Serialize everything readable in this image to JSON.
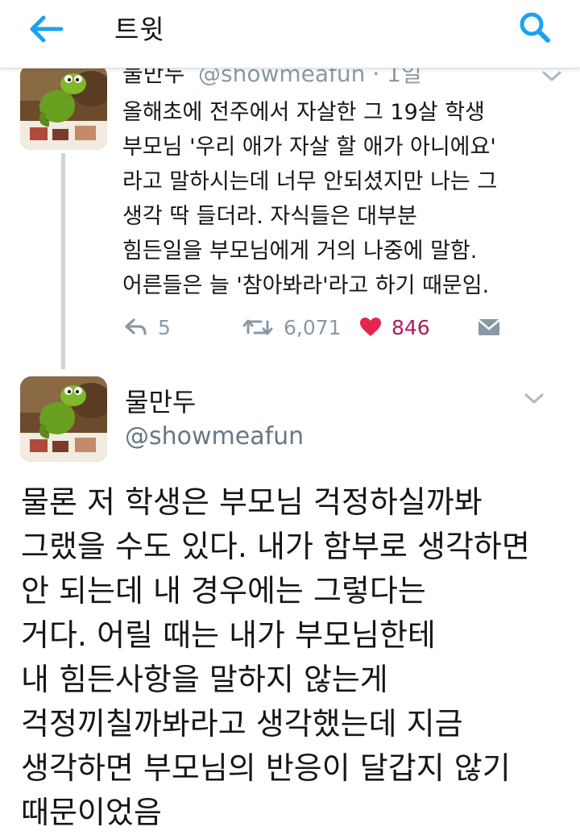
{
  "header": {
    "title": "트윗"
  },
  "reply_tweet": {
    "name": "물만두",
    "handle_time": "@showmeafun · 1일",
    "lines": [
      "올해초에 전주에서 자살한 그 19살 학생",
      "부모님 '우리 애가 자살 할 애가 아니에요'",
      "라고 말하시는데 너무 안되셨지만 나는 그",
      "생각 딱 들더라. 자식들은 대부분",
      "힘든일을 부모님에게 거의 나중에 말함.",
      "어른들은 늘 '참아봐라'라고 하기 때문임."
    ],
    "actions": {
      "reply_count": "5",
      "retweet_count": "6,071",
      "like_count": "846"
    }
  },
  "main_tweet": {
    "name": "물만두",
    "handle": "@showmeafun",
    "lines": [
      "물론 저 학생은 부모님 걱정하실까봐",
      "그랬을 수도 있다. 내가 함부로 생각하면",
      "안 되는데 내 경우에는 그렇다는",
      "거다. 어릴 때는 내가 부모님한테",
      "내 힘든사항을 말하지 않는게",
      "걱정끼칠까봐라고 생각했는데 지금",
      "생각하면 부모님의 반응이 달갑지 않기",
      "때문이었음"
    ]
  },
  "icons": {
    "back": "back-arrow-icon",
    "search": "search-icon",
    "chevron": "chevron-down-icon",
    "reply": "reply-icon",
    "retweet": "retweet-icon",
    "like": "heart-icon",
    "dm": "direct-message-icon"
  },
  "colors": {
    "accent": "#1da1f2",
    "like": "#e2264d",
    "like_count": "#b0195c",
    "secondary_text": "#8899a6",
    "primary_text": "#14171a"
  }
}
